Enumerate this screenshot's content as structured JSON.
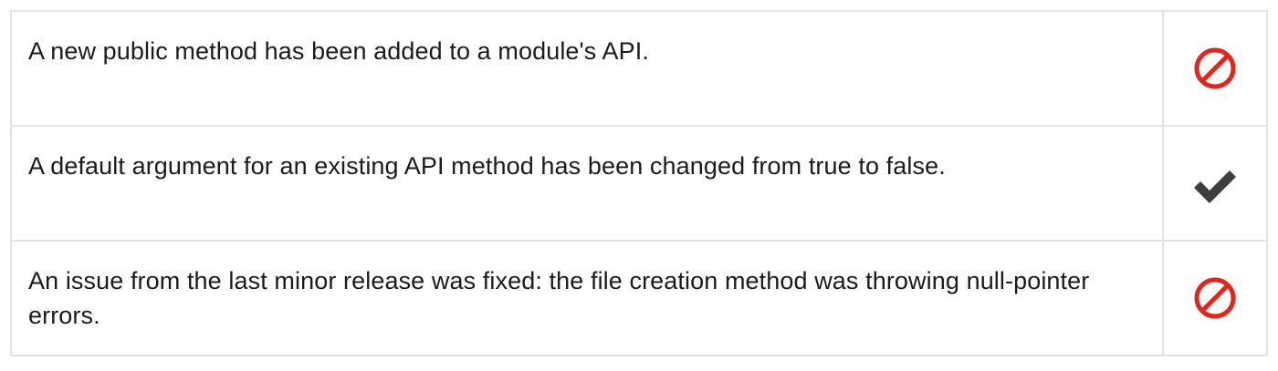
{
  "rows": [
    {
      "text": "A new public method has been added to a module's API.",
      "icon": "prohibited-icon",
      "icon_color": "#e0261e"
    },
    {
      "text": "A default argument for an existing API method has been changed from true to false.",
      "icon": "checkmark-icon",
      "icon_color": "#3d3d3d"
    },
    {
      "text": "An issue from the last minor release was fixed: the file creation method was throwing null-pointer errors.",
      "icon": "prohibited-icon",
      "icon_color": "#e0261e"
    }
  ]
}
